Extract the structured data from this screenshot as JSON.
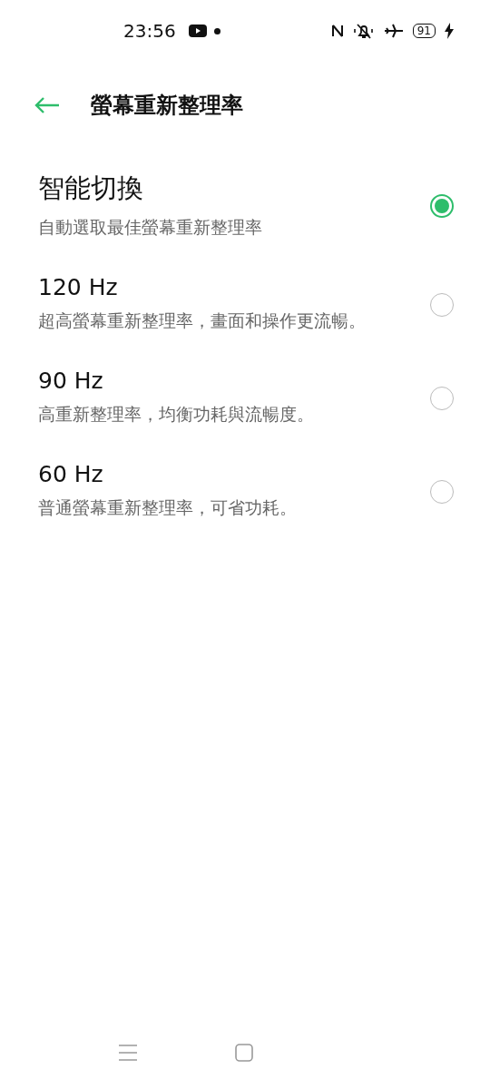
{
  "status_bar": {
    "time": "23:56",
    "battery": "91"
  },
  "header": {
    "title": "螢幕重新整理率"
  },
  "options": [
    {
      "title": "智能切換",
      "subtitle": "自動選取最佳螢幕重新整理率",
      "selected": true
    },
    {
      "title": "120 Hz",
      "subtitle": "超高螢幕重新整理率，畫面和操作更流暢。",
      "selected": false
    },
    {
      "title": "90 Hz",
      "subtitle": "高重新整理率，均衡功耗與流暢度。",
      "selected": false
    },
    {
      "title": "60 Hz",
      "subtitle": "普通螢幕重新整理率，可省功耗。",
      "selected": false
    }
  ]
}
